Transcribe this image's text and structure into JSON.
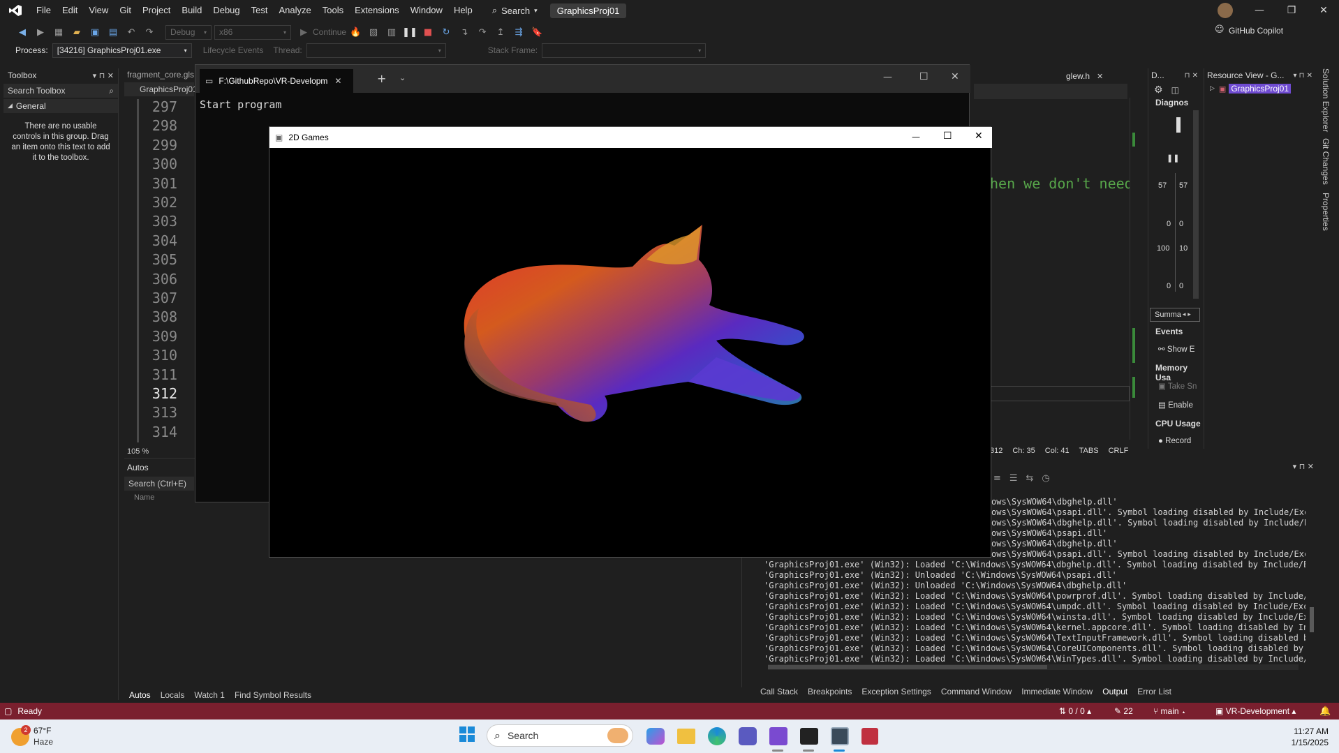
{
  "menubar": {
    "items": [
      "File",
      "Edit",
      "View",
      "Git",
      "Project",
      "Build",
      "Debug",
      "Test",
      "Analyze",
      "Tools",
      "Extensions",
      "Window",
      "Help"
    ],
    "search_label": "Search",
    "project_name": "GraphicsProj01"
  },
  "toolbar": {
    "config": "Debug",
    "platform": "x86",
    "continue_label": "Continue",
    "github_copilot": "GitHub Copilot",
    "process_label": "Process:",
    "process_value": "[34216] GraphicsProj01.exe",
    "lifecycle_label": "Lifecycle Events",
    "thread_label": "Thread:",
    "stackframe_label": "Stack Frame:"
  },
  "toolbox": {
    "title": "Toolbox",
    "search_placeholder": "Search Toolbox",
    "group": "General",
    "empty_text": "There are no usable controls in this group. Drag an item onto this text to add it to the toolbox."
  },
  "editor": {
    "tab_label": "fragment_core.gls",
    "project_tab": "GraphicsProj01",
    "line_numbers": [
      "297",
      "298",
      "299",
      "300",
      "301",
      "302",
      "303",
      "304",
      "305",
      "306",
      "307",
      "308",
      "309",
      "310",
      "311",
      "312",
      "313",
      "314"
    ],
    "current_line": "312",
    "zoom": "105 %",
    "code_fragment": "hen we don't need",
    "second_tab": "glew.h",
    "status_ln": "312",
    "status_ch": "Ch: 35",
    "status_col": "Col: 41",
    "status_tabs": "TABS",
    "status_crlf": "CRLF"
  },
  "diagnostics": {
    "title": "D...",
    "header": "Diagnos",
    "values": [
      "57",
      "57",
      "0",
      "0",
      "100",
      "10",
      "0",
      "0"
    ],
    "summary_tab": "Summa",
    "events_label": "Events",
    "show_events": "Show E",
    "memory_label": "Memory Usa",
    "take_snapshot": "Take Sn",
    "enable": "Enable",
    "cpu_label": "CPU Usage",
    "record": "Record"
  },
  "resource_view": {
    "title": "Resource View - G...",
    "item": "GraphicsProj01"
  },
  "side_tabs": [
    "Solution Explorer",
    "Git Changes",
    "Properties"
  ],
  "console": {
    "tab_title": "F:\\GithubRepo\\VR-Developm",
    "text": "Start program"
  },
  "game_window": {
    "title": "2D Games"
  },
  "autos": {
    "title": "Autos",
    "search_placeholder": "Search (Ctrl+E)",
    "col_name": "Name",
    "tabs": [
      "Autos",
      "Locals",
      "Watch 1",
      "Find Symbol Results"
    ]
  },
  "output": {
    "lines": [
      "ows\\SysWOW64\\dbghelp.dll'",
      "ows\\SysWOW64\\psapi.dll'. Symbol loading disabled by Include/Exclu",
      "ows\\SysWOW64\\dbghelp.dll'. Symbol loading disabled by Include/Excl",
      "ows\\SysWOW64\\psapi.dll'",
      "ows\\SysWOW64\\dbghelp.dll'",
      "ows\\SysWOW64\\psapi.dll'. Symbol loading disabled by Include/Exclu",
      "'GraphicsProj01.exe' (Win32): Loaded 'C:\\Windows\\SysWOW64\\dbghelp.dll'. Symbol loading disabled by Include/Excl",
      "'GraphicsProj01.exe' (Win32): Unloaded 'C:\\Windows\\SysWOW64\\psapi.dll'",
      "'GraphicsProj01.exe' (Win32): Unloaded 'C:\\Windows\\SysWOW64\\dbghelp.dll'",
      "'GraphicsProj01.exe' (Win32): Loaded 'C:\\Windows\\SysWOW64\\powrprof.dll'. Symbol loading disabled by Include/Exc",
      "'GraphicsProj01.exe' (Win32): Loaded 'C:\\Windows\\SysWOW64\\umpdc.dll'. Symbol loading disabled by Include/Exclu",
      "'GraphicsProj01.exe' (Win32): Loaded 'C:\\Windows\\SysWOW64\\winsta.dll'. Symbol loading disabled by Include/Exclu",
      "'GraphicsProj01.exe' (Win32): Loaded 'C:\\Windows\\SysWOW64\\kernel.appcore.dll'. Symbol loading disabled by Inclu",
      "'GraphicsProj01.exe' (Win32): Loaded 'C:\\Windows\\SysWOW64\\TextInputFramework.dll'. Symbol loading disabled by I",
      "'GraphicsProj01.exe' (Win32): Loaded 'C:\\Windows\\SysWOW64\\CoreUIComponents.dll'. Symbol loading disabled by Inc",
      "'GraphicsProj01.exe' (Win32): Loaded 'C:\\Windows\\SysWOW64\\WinTypes.dll'. Symbol loading disabled by Include/Exc"
    ],
    "tabs": [
      "Call Stack",
      "Breakpoints",
      "Exception Settings",
      "Command Window",
      "Immediate Window",
      "Output",
      "Error List"
    ],
    "active_tab": "Output"
  },
  "statusbar": {
    "ready": "Ready",
    "sync": "0 / 0",
    "edits": "22",
    "branch": "main",
    "repo": "VR-Development"
  },
  "taskbar": {
    "weather_temp": "67°F",
    "weather_desc": "Haze",
    "weather_badge": "2",
    "search_label": "Search",
    "time": "11:27 AM",
    "date": "1/15/2025"
  },
  "colors": {
    "status_bar": "#7a1f2e",
    "accent": "#6f4bd1"
  }
}
